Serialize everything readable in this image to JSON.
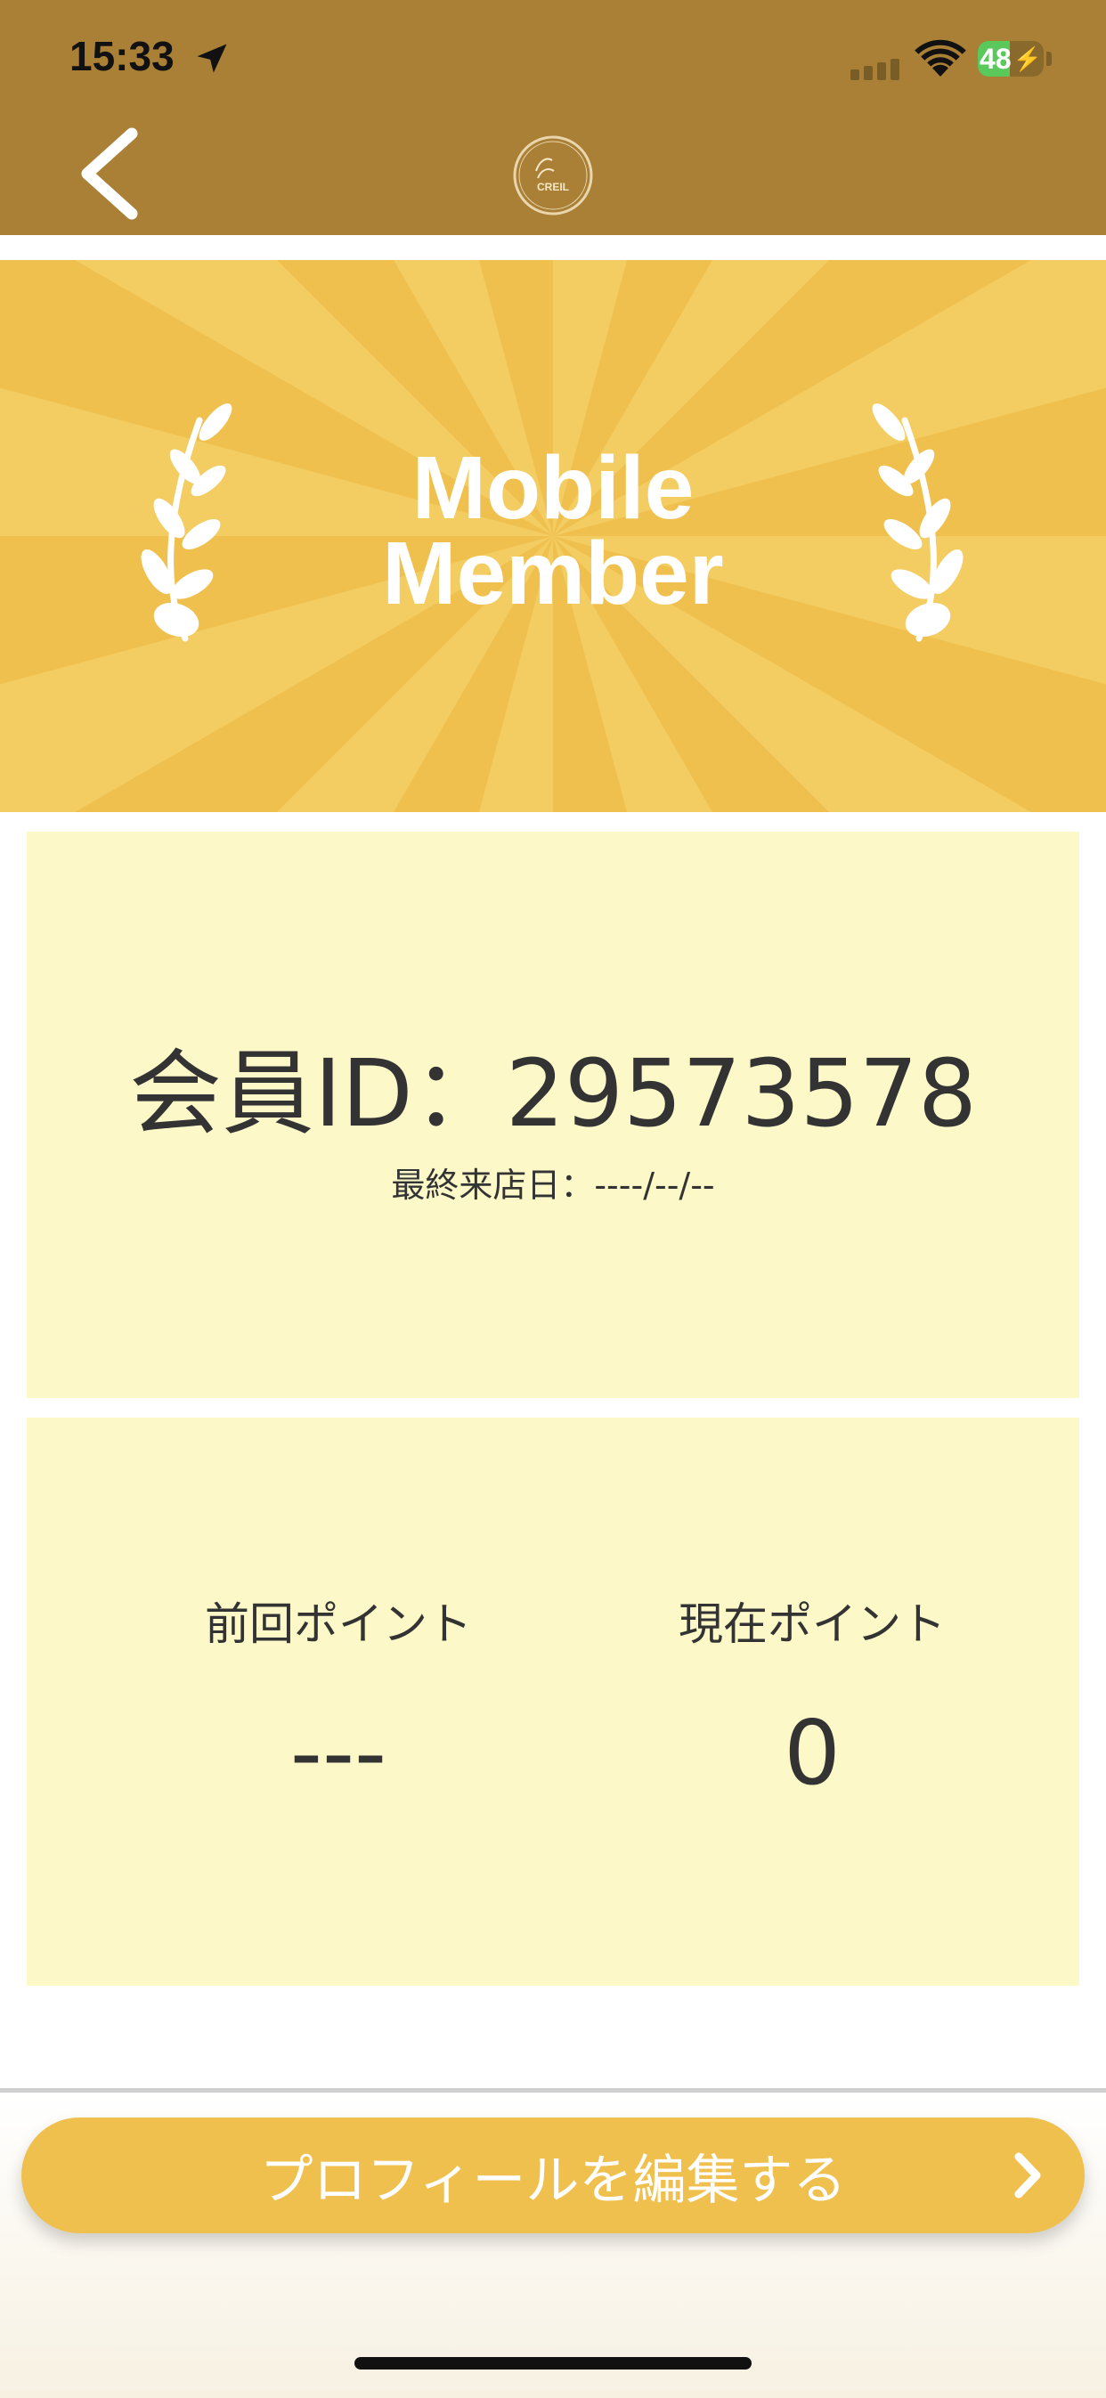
{
  "status_bar": {
    "time": "15:33",
    "battery_level": "48",
    "battery_fraction": 0.48,
    "icons": [
      "location-arrow-icon",
      "cellular-signal-icon",
      "wifi-icon",
      "battery-charging-icon"
    ]
  },
  "header": {
    "back_icon": "chevron-left-icon",
    "logo": "salon-logo",
    "logo_text": "CREIL",
    "colors": {
      "header_bg": "#a98036"
    }
  },
  "banner": {
    "title_line1": "Mobile",
    "title_line2": "Member",
    "decoration": "laurel-branch-icon",
    "colors": {
      "banner_bg": "#f0c04e",
      "ray": "#f3cc62",
      "text": "#ffffff"
    }
  },
  "member_card": {
    "member_id_text": "会員ID：29573578",
    "last_visit_text": "最終来店日：----/--/--",
    "colors": {
      "card_bg": "#fcf8c8"
    }
  },
  "points_card": {
    "previous_points_label": "前回ポイント",
    "previous_points_value": "---",
    "current_points_label": "現在ポイント",
    "current_points_value": "0"
  },
  "footer": {
    "edit_profile_label": "プロフィールを編集する",
    "edit_profile_icon": "chevron-right-icon",
    "colors": {
      "button_bg": "#f0c04e",
      "button_text": "#ffffff"
    }
  }
}
